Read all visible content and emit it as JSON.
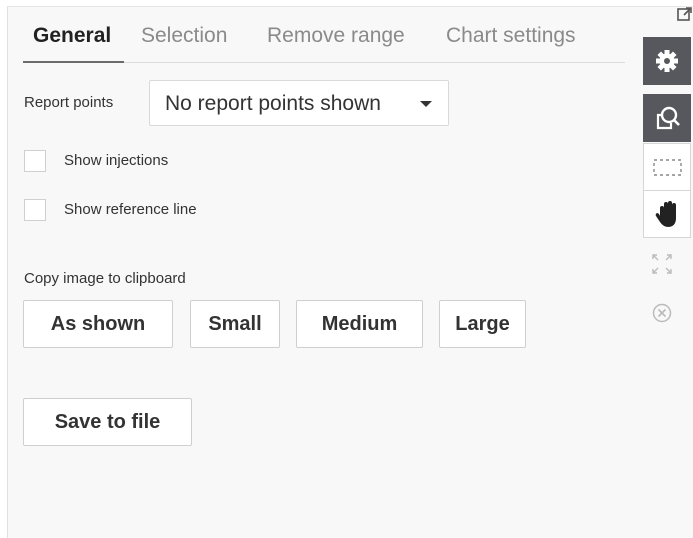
{
  "tabs": [
    {
      "label": "General",
      "active": true
    },
    {
      "label": "Selection",
      "active": false
    },
    {
      "label": "Remove range",
      "active": false
    },
    {
      "label": "Chart settings",
      "active": false
    }
  ],
  "report_points": {
    "label": "Report points",
    "selected": "No report points shown"
  },
  "options": {
    "show_injections": "Show injections",
    "show_reference_line": "Show reference line"
  },
  "copy": {
    "label": "Copy image to clipboard",
    "as_shown": "As shown",
    "small": "Small",
    "medium": "Medium",
    "large": "Large"
  },
  "save": {
    "label": "Save to file"
  },
  "toolbar": {
    "icons": [
      "popout-icon",
      "gear-icon",
      "zoom-icon",
      "select-rectangle-icon",
      "pan-hand-icon",
      "fit-to-screen-icon",
      "close-circle-icon"
    ],
    "dark_color": "#56585e"
  }
}
